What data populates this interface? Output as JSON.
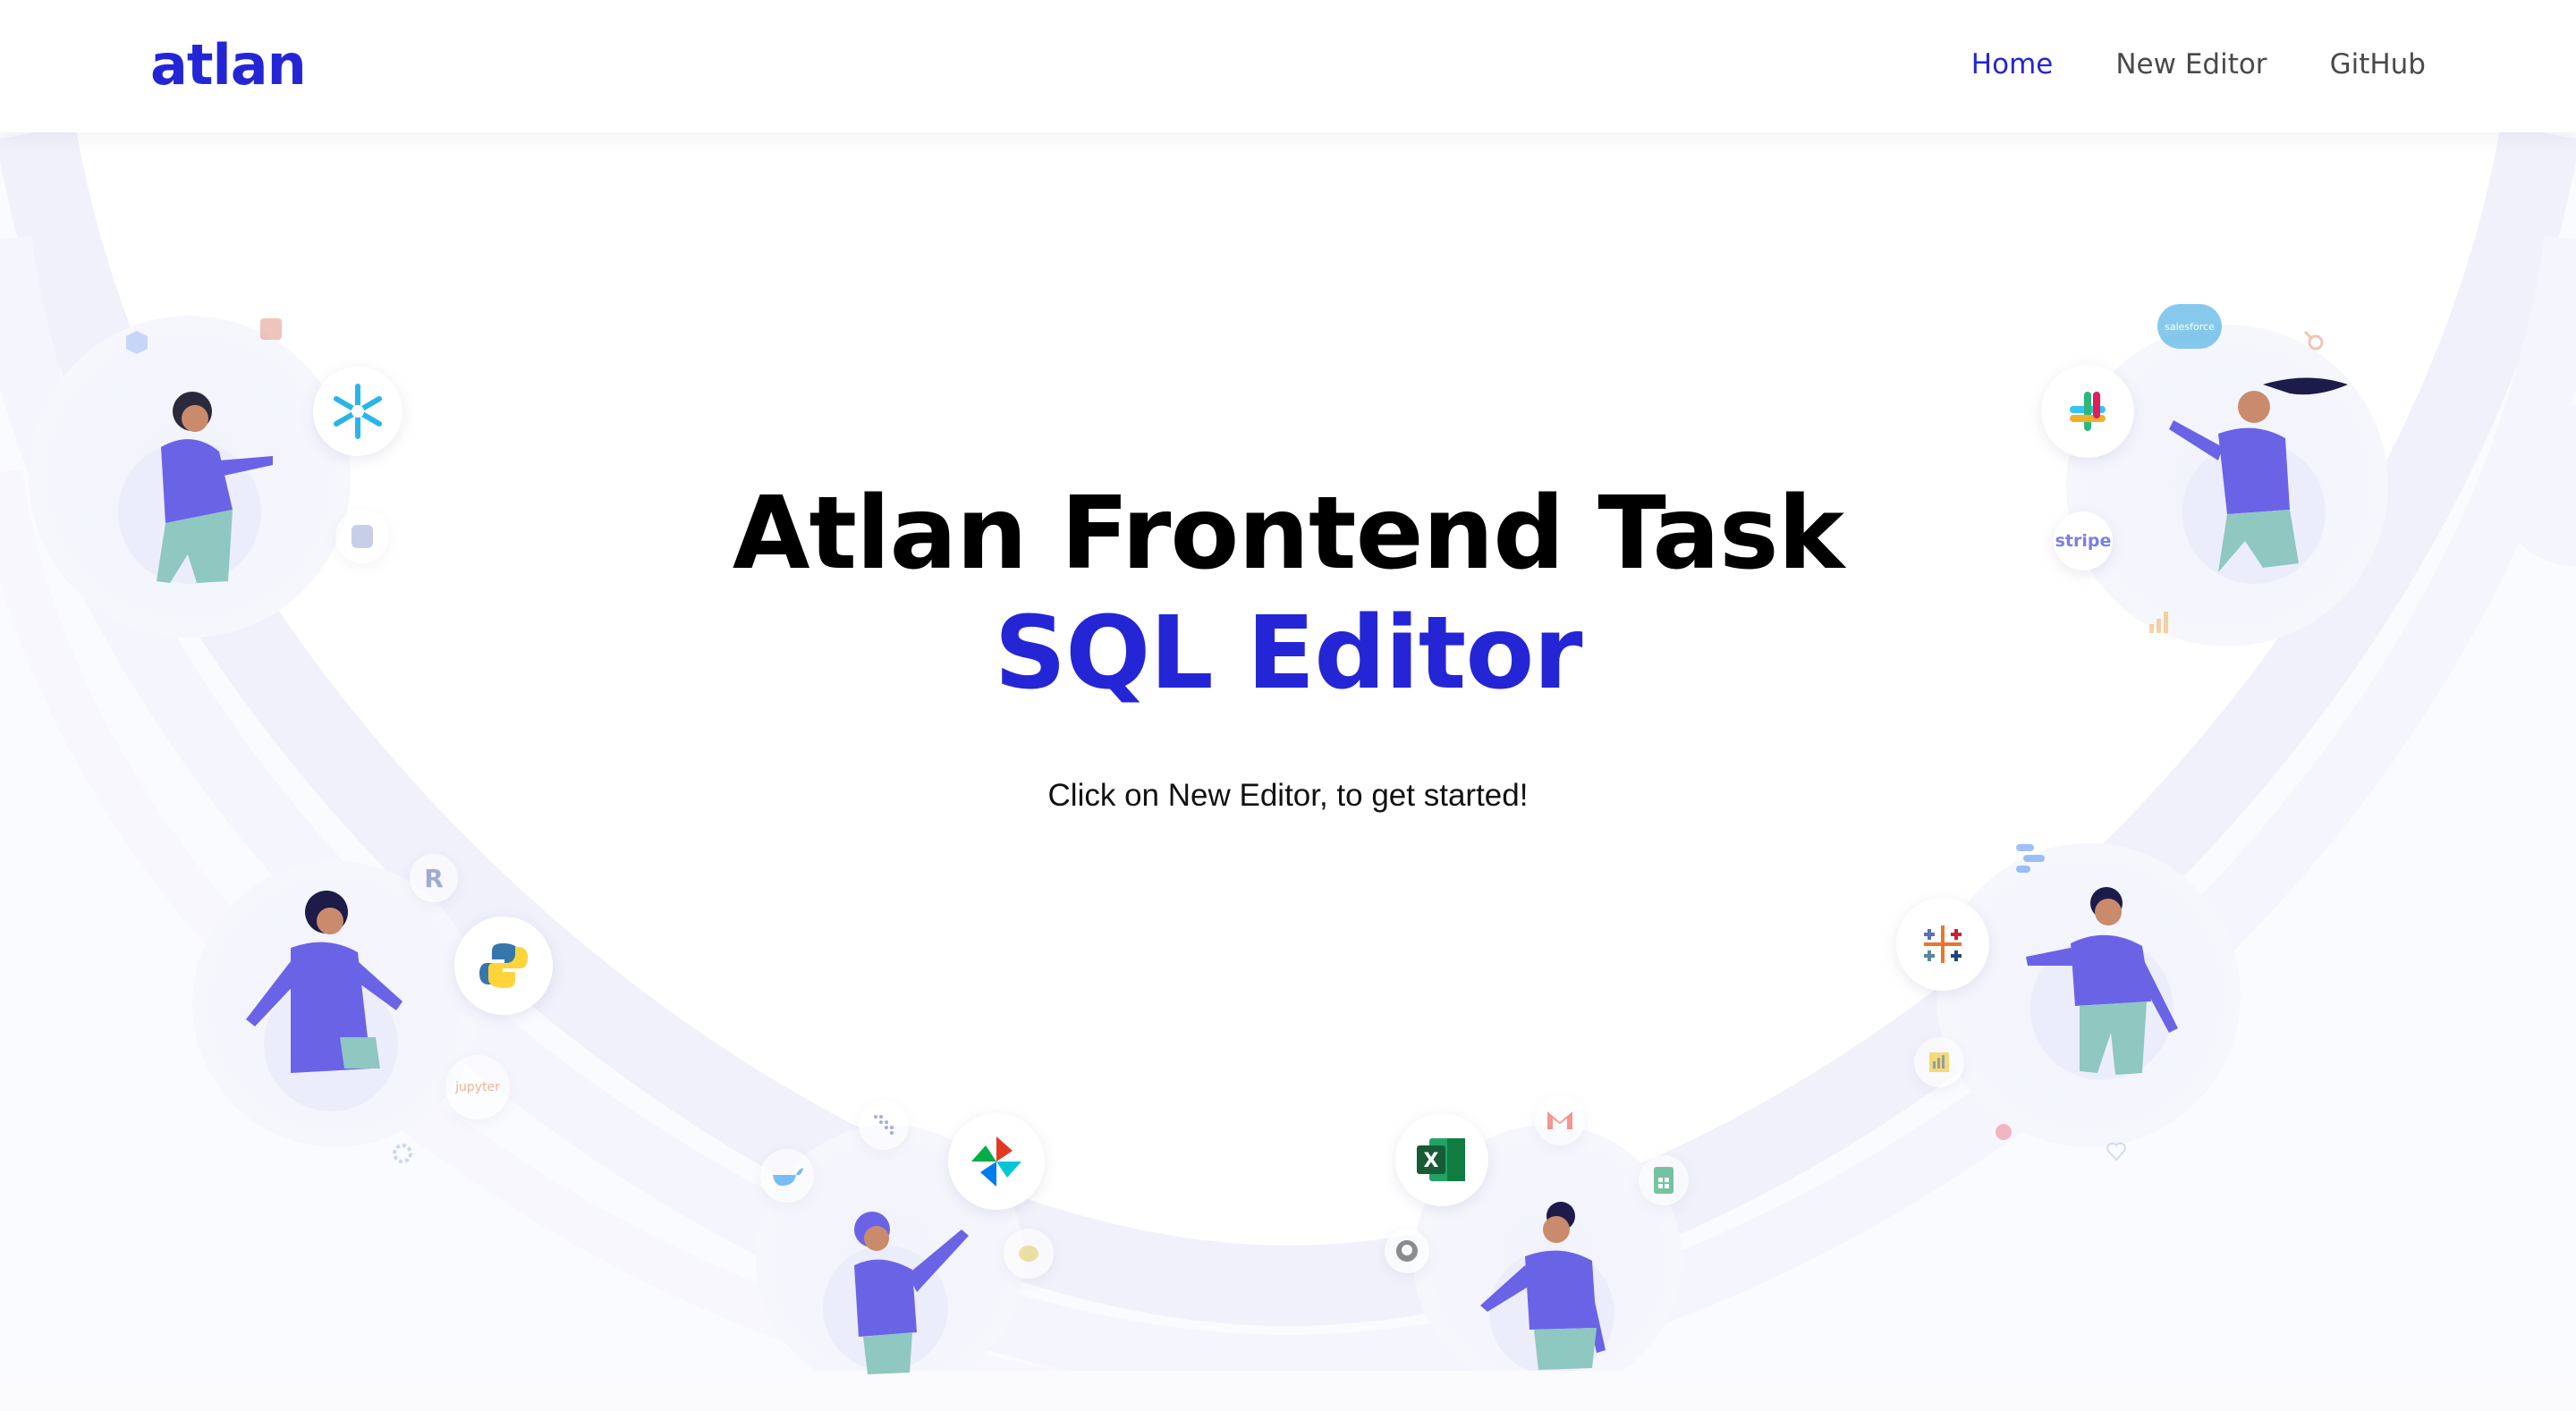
{
  "nav": {
    "logo": "atlan",
    "links": [
      "Home",
      "New Editor",
      "GitHub"
    ],
    "active": "Home"
  },
  "hero": {
    "title": "Atlan Frontend Task",
    "subtitle": "SQL Editor",
    "text": "Click on New Editor, to get started!"
  },
  "icons": {
    "stripe": "stripe",
    "salesforce": "salesforce",
    "excel": "X",
    "r": "R",
    "jupyter": "jupyter"
  },
  "colors": {
    "brand": "#2426d6",
    "person_body": "#6b63e6",
    "person_pants": "#8fc7c1",
    "bubble_bg": "#eef0fb"
  }
}
